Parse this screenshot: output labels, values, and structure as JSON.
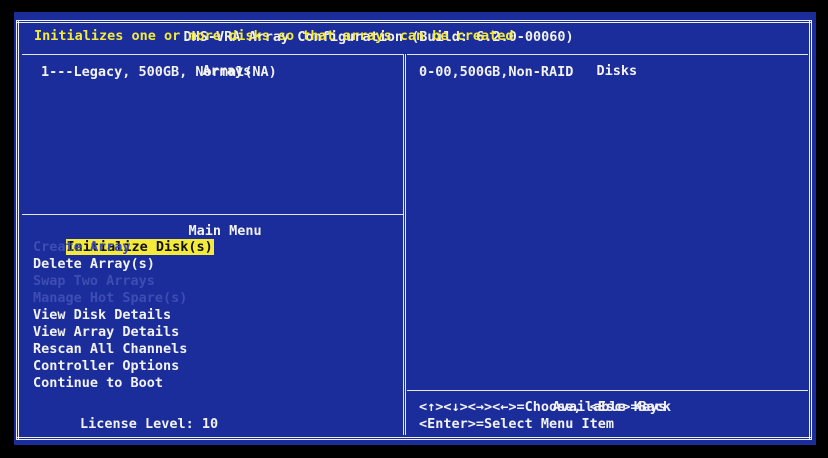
{
  "app": {
    "title": "DHS-VRA Array Configuration (Build: 6.2.0-00060)",
    "hint": "Initializes one or more disks so that arrays can be created"
  },
  "arrays": {
    "title": "Arrays",
    "items": [
      "1---Legacy, 500GB, Normal(NA)"
    ]
  },
  "disks": {
    "title": "Disks",
    "items": [
      "0-00,500GB,Non-RAID"
    ]
  },
  "main_menu": {
    "title": "Main Menu",
    "items": [
      {
        "label": "Initialize Disk(s)",
        "state": "selected"
      },
      {
        "label": "Create Array",
        "state": "disabled"
      },
      {
        "label": "Delete Array(s)",
        "state": "enabled"
      },
      {
        "label": "Swap Two Arrays",
        "state": "disabled"
      },
      {
        "label": "Manage Hot Spare(s)",
        "state": "disabled"
      },
      {
        "label": "View Disk Details",
        "state": "enabled"
      },
      {
        "label": "View Array Details",
        "state": "enabled"
      },
      {
        "label": "Rescan All Channels",
        "state": "enabled"
      },
      {
        "label": "Controller Options",
        "state": "enabled"
      },
      {
        "label": "Continue to Boot",
        "state": "enabled"
      }
    ],
    "license": "License Level: 10"
  },
  "keys": {
    "title": "Available Keys",
    "line1": "<↑><↓><→><←>=Choose, <Esc>=Back",
    "line2": "<Enter>=Select Menu Item"
  },
  "colors": {
    "background": "#1b2d9b",
    "hint_text": "#f4ea3c",
    "selected_highlight": "#f4ea3c",
    "disabled_text": "#3e4db4"
  }
}
